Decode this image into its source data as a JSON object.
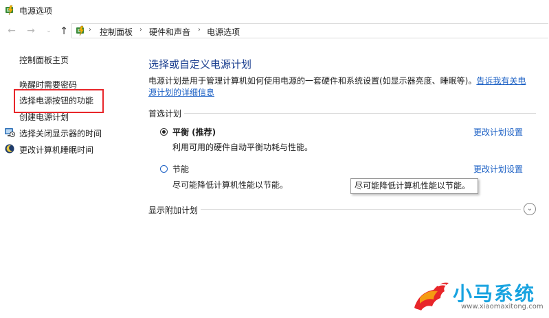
{
  "window": {
    "title": "电源选项"
  },
  "nav": {
    "back_icon": "arrow-left-icon",
    "forward_icon": "arrow-right-icon",
    "recent_icon": "chevron-down-icon",
    "up_icon": "arrow-up-icon",
    "breadcrumb": [
      "控制面板",
      "硬件和声音",
      "电源选项"
    ]
  },
  "left_pane": {
    "home": "控制面板主页",
    "items": [
      {
        "label": "唤醒时需要密码",
        "icon": null
      },
      {
        "label": "选择电源按钮的功能",
        "icon": null
      },
      {
        "label": "创建电源计划",
        "icon": null
      },
      {
        "label": "选择关闭显示器的时间",
        "icon": "monitor-icon"
      },
      {
        "label": "更改计算机睡眠时间",
        "icon": "moon-icon"
      }
    ],
    "highlight_color": "#e8262a"
  },
  "main": {
    "heading": "选择或自定义电源计划",
    "description": "电源计划是用于管理计算机如何使用电源的一套硬件和系统设置(如显示器亮度、睡眠等)。",
    "description_link": "告诉我有关电源计划的详细信息",
    "preferred_label": "首选计划",
    "plans": [
      {
        "name": "平衡 (推荐)",
        "desc": "利用可用的硬件自动平衡功耗与性能。",
        "link": "更改计划设置",
        "selected": true
      },
      {
        "name": "节能",
        "desc": "尽可能降低计算机性能以节能。",
        "link": "更改计划设置",
        "selected": false
      }
    ],
    "tooltip": "尽可能降低计算机性能以节能。",
    "additional_label": "显示附加计划",
    "expander_icon": "chevron-down-circle-icon"
  },
  "watermark": {
    "brand": "小马系统",
    "url": "www.xiaomaxitong.com"
  },
  "colors": {
    "heading": "#1a3e8f",
    "link": "#1a5fc4",
    "brand": "#18a3e0"
  }
}
